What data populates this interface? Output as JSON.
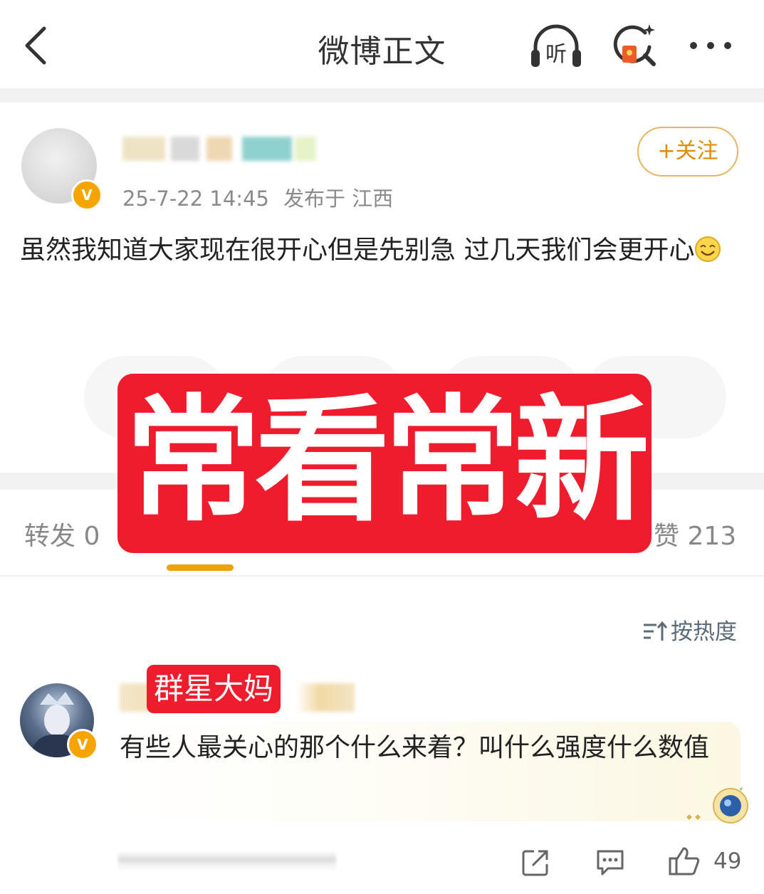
{
  "header": {
    "title": "微博正文",
    "listen_label": "听"
  },
  "post": {
    "verified_badge": "V",
    "timestamp": "25-7-22 14:45",
    "location": "发布于 江西",
    "follow_label": "+关注",
    "text": "虽然我知道大家现在很开心但是先别急 过几天我们会更开心"
  },
  "overlay": {
    "stamp_text": "常看常新"
  },
  "tabs": {
    "repost": "转发 0",
    "like": "赞 213"
  },
  "sort": {
    "label": "按热度"
  },
  "comment": {
    "label": "群星大妈",
    "verified_badge": "V",
    "text": "有些人最关心的那个什么来着？叫什么强度什么数值",
    "like_count": "49"
  },
  "colors": {
    "accent": "#f1a00c",
    "stamp_red": "#ef1c2d",
    "verified": "#f6a400"
  }
}
